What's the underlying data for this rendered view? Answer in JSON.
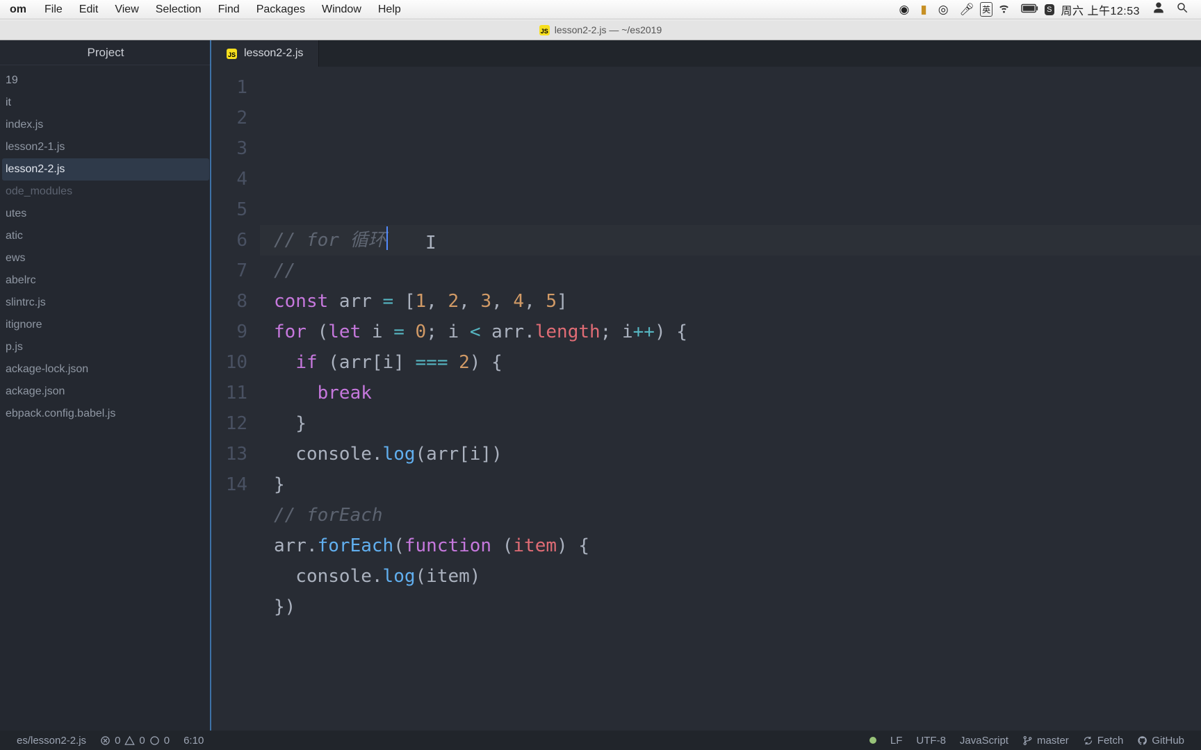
{
  "menubar": {
    "app": "om",
    "items": [
      "File",
      "Edit",
      "View",
      "Selection",
      "Find",
      "Packages",
      "Window",
      "Help"
    ],
    "clock": "周六 上午12:53"
  },
  "window": {
    "title": "lesson2-2.js — ~/es2019"
  },
  "sidebar": {
    "header": "Project",
    "root": "19",
    "node2": "it",
    "files": [
      "index.js",
      "lesson2-1.js",
      "lesson2-2.js",
      "ode_modules",
      "utes",
      "atic",
      "ews",
      "abelrc",
      "slintrc.js",
      "itignore",
      "p.js",
      "ackage-lock.json",
      "ackage.json",
      "ebpack.config.babel.js"
    ],
    "selected": "lesson2-2.js",
    "muted": [
      "ode_modules"
    ]
  },
  "tab": {
    "name": "lesson2-2.js"
  },
  "code": {
    "lines": 14,
    "tokens": [
      [
        {
          "t": "// for 循环",
          "c": "c"
        }
      ],
      [
        {
          "t": "//",
          "c": "c"
        }
      ],
      [
        {
          "t": "const ",
          "c": "kw"
        },
        {
          "t": "arr ",
          "c": "pl"
        },
        {
          "t": "= ",
          "c": "op"
        },
        {
          "t": "[",
          "c": "pl"
        },
        {
          "t": "1",
          "c": "num"
        },
        {
          "t": ", ",
          "c": "pl"
        },
        {
          "t": "2",
          "c": "num"
        },
        {
          "t": ", ",
          "c": "pl"
        },
        {
          "t": "3",
          "c": "num"
        },
        {
          "t": ", ",
          "c": "pl"
        },
        {
          "t": "4",
          "c": "num"
        },
        {
          "t": ", ",
          "c": "pl"
        },
        {
          "t": "5",
          "c": "num"
        },
        {
          "t": "]",
          "c": "pl"
        }
      ],
      [
        {
          "t": "for ",
          "c": "kw"
        },
        {
          "t": "(",
          "c": "pl"
        },
        {
          "t": "let ",
          "c": "kw"
        },
        {
          "t": "i ",
          "c": "pl"
        },
        {
          "t": "= ",
          "c": "op"
        },
        {
          "t": "0",
          "c": "num"
        },
        {
          "t": "; i ",
          "c": "pl"
        },
        {
          "t": "< ",
          "c": "op"
        },
        {
          "t": "arr.",
          "c": "pl"
        },
        {
          "t": "length",
          "c": "prop"
        },
        {
          "t": "; i",
          "c": "pl"
        },
        {
          "t": "++",
          "c": "op"
        },
        {
          "t": ") {",
          "c": "pl"
        }
      ],
      [
        {
          "t": "  ",
          "c": "pl"
        },
        {
          "t": "if ",
          "c": "kw"
        },
        {
          "t": "(arr[i] ",
          "c": "pl"
        },
        {
          "t": "=== ",
          "c": "op"
        },
        {
          "t": "2",
          "c": "num"
        },
        {
          "t": ") {",
          "c": "pl"
        }
      ],
      [
        {
          "t": "    ",
          "c": "pl"
        },
        {
          "t": "break",
          "c": "kw"
        }
      ],
      [
        {
          "t": "  }",
          "c": "pl"
        }
      ],
      [
        {
          "t": "  console.",
          "c": "pl"
        },
        {
          "t": "log",
          "c": "fn"
        },
        {
          "t": "(arr[i])",
          "c": "pl"
        }
      ],
      [
        {
          "t": "}",
          "c": "pl"
        }
      ],
      [
        {
          "t": "// forEach",
          "c": "c"
        }
      ],
      [
        {
          "t": "arr.",
          "c": "pl"
        },
        {
          "t": "forEach",
          "c": "fn"
        },
        {
          "t": "(",
          "c": "pl"
        },
        {
          "t": "function ",
          "c": "kw"
        },
        {
          "t": "(",
          "c": "pl"
        },
        {
          "t": "item",
          "c": "prop"
        },
        {
          "t": ") {",
          "c": "pl"
        }
      ],
      [
        {
          "t": "  console.",
          "c": "pl"
        },
        {
          "t": "log",
          "c": "fn"
        },
        {
          "t": "(item)",
          "c": "pl"
        }
      ],
      [
        {
          "t": "})",
          "c": "pl"
        }
      ],
      []
    ]
  },
  "status": {
    "path": "es/lesson2-2.js",
    "diag": "0  0  0",
    "cursor": "6:10",
    "eol": "LF",
    "enc": "UTF-8",
    "lang": "JavaScript",
    "branch": "master",
    "fetch": "Fetch",
    "gh": "GitHub"
  }
}
